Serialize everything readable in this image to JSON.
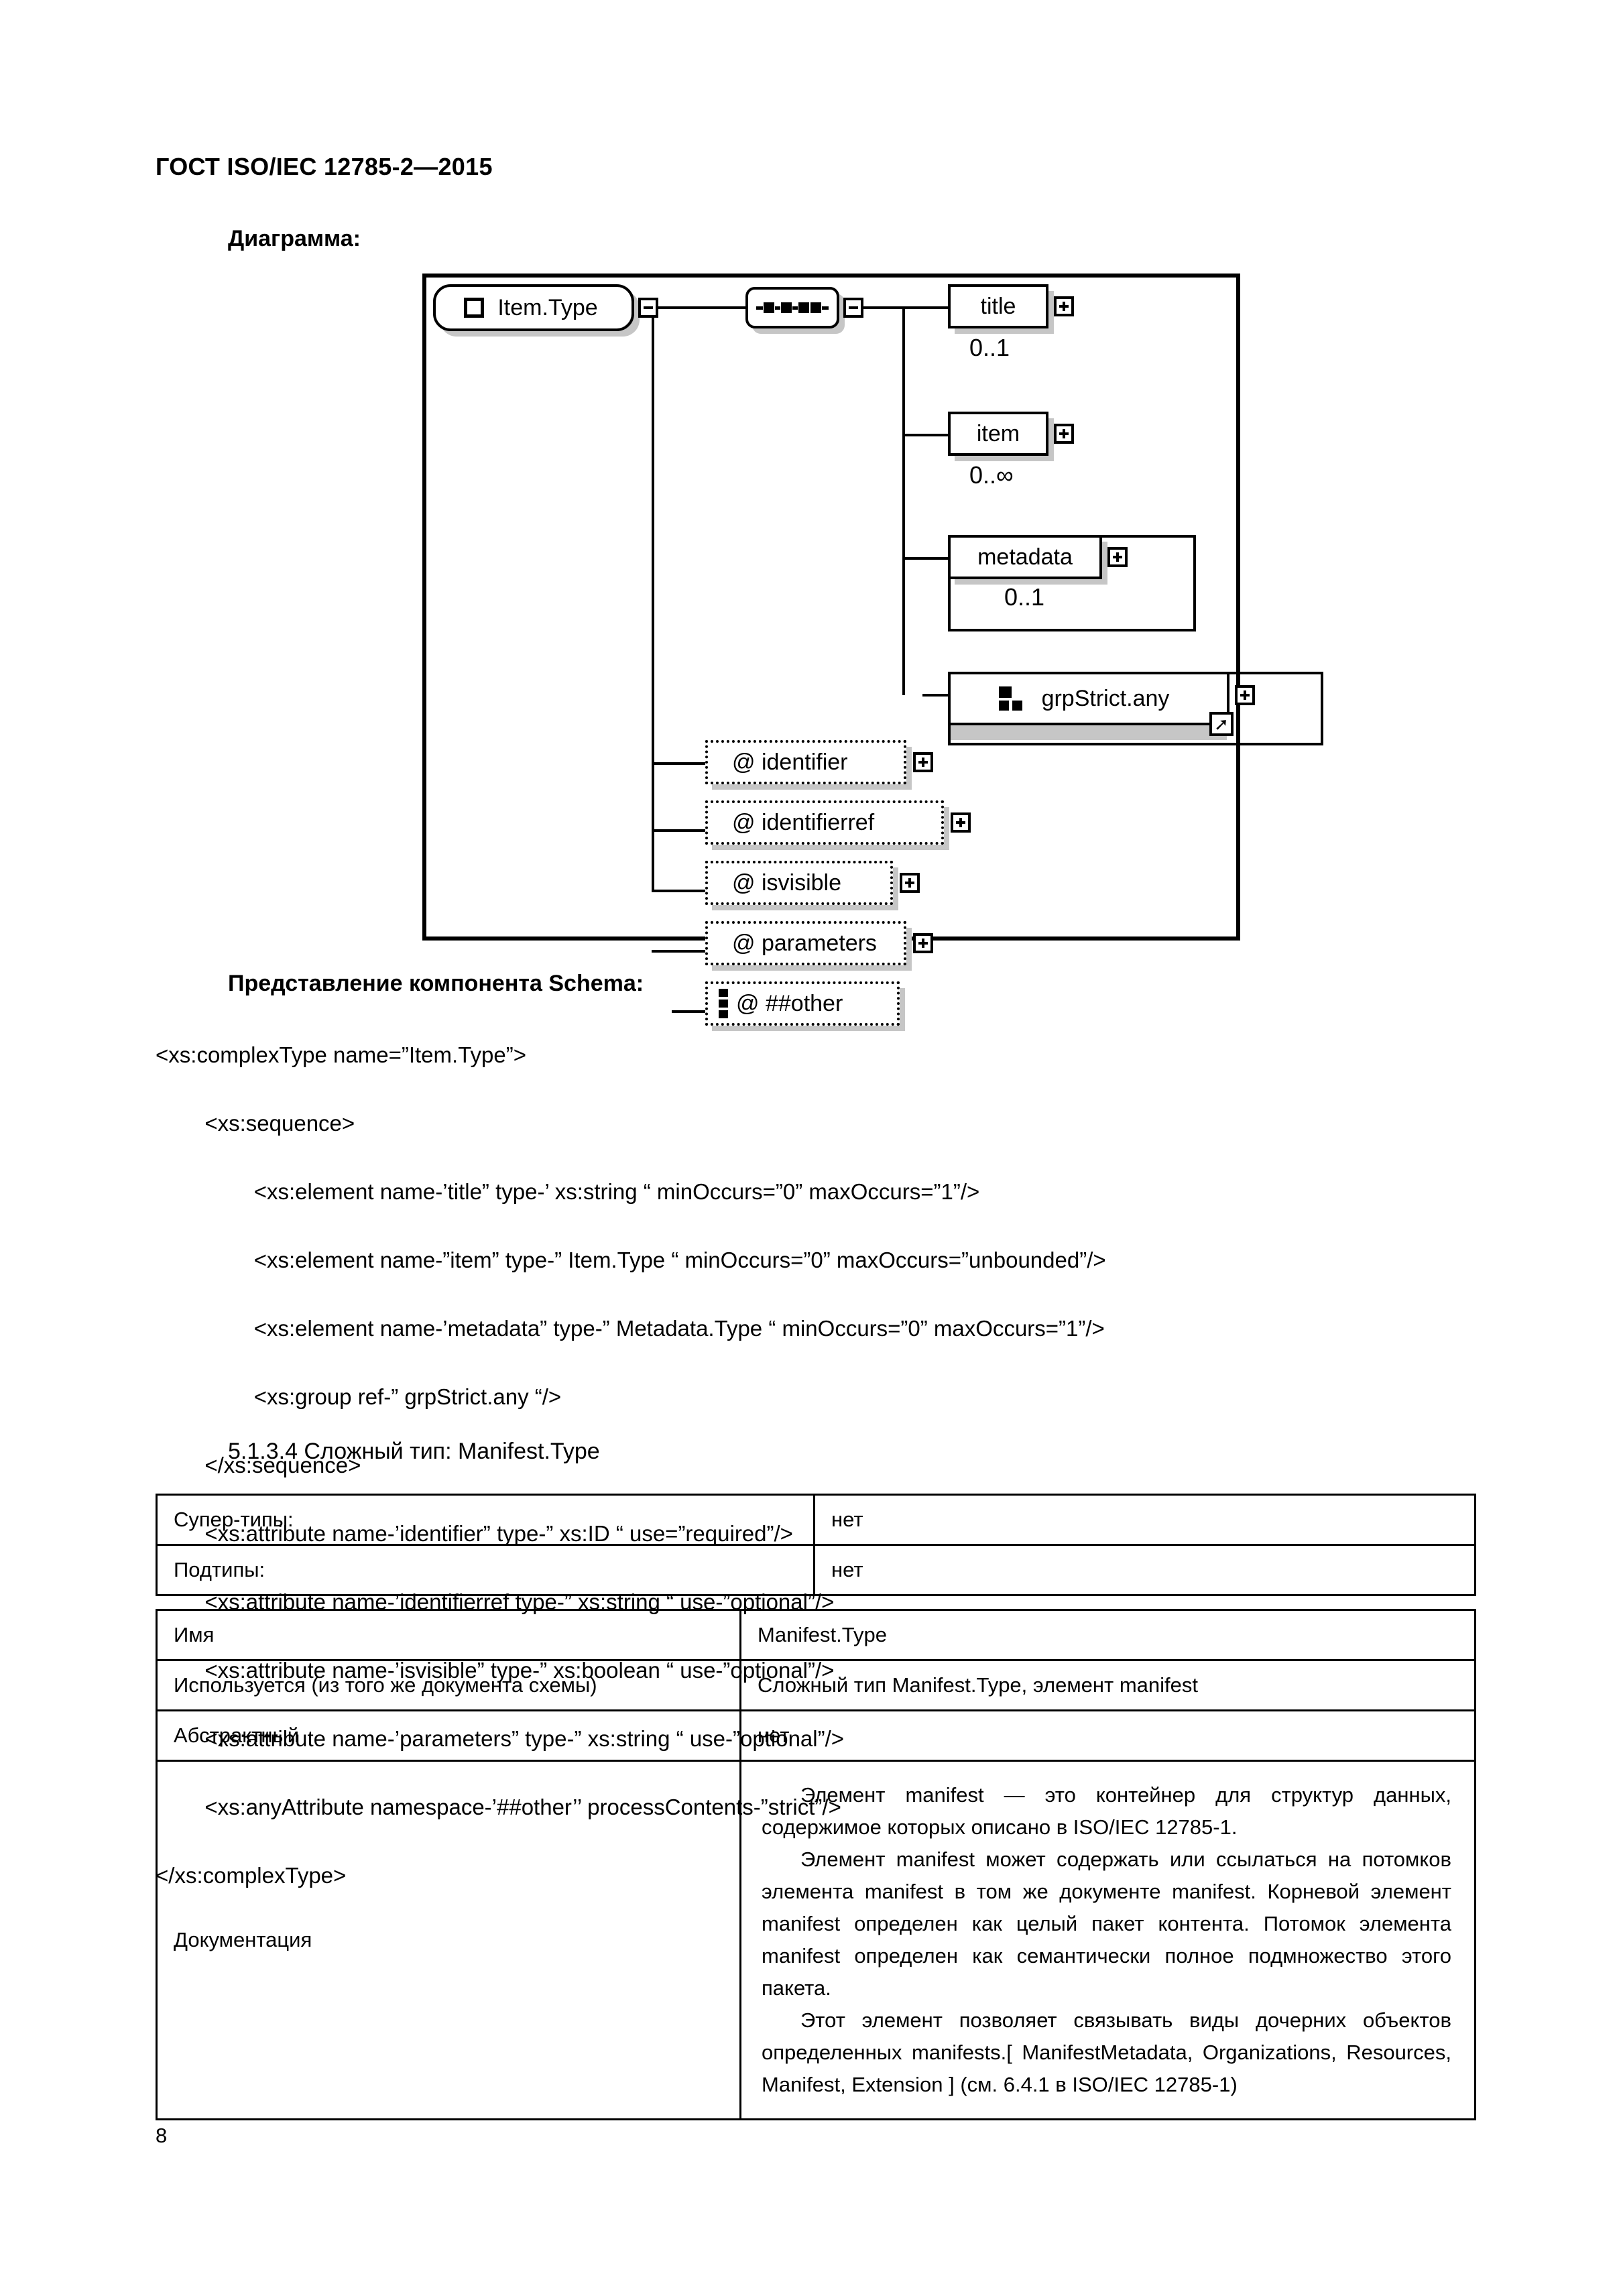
{
  "header": {
    "standard_title": "ГОСТ ISO/IEC 12785-2—2015"
  },
  "labels": {
    "diagram": "Диаграмма:",
    "schema_component": "Представление компонента Schema:",
    "clause": "5.1.3.4  Сложный тип: Manifest.Type"
  },
  "diagram": {
    "root": {
      "name": "Item.Type",
      "expander": "-"
    },
    "compositor": {
      "kind": "sequence",
      "expander": "-"
    },
    "elements": [
      {
        "name": "title",
        "cardinality": "0..1",
        "expander": "+"
      },
      {
        "name": "item",
        "cardinality": "0..∞",
        "expander": "+"
      },
      {
        "name": "metadata",
        "cardinality": "0..1",
        "expander": "+"
      },
      {
        "name": "grpStrict.any",
        "cardinality": "",
        "expander": "+"
      }
    ],
    "attributes": [
      {
        "name": "@ identifier",
        "expander": "+"
      },
      {
        "name": "@ identifierref",
        "expander": "+"
      },
      {
        "name": "@ isvisible",
        "expander": "+"
      },
      {
        "name": "@ parameters",
        "expander": "+"
      },
      {
        "name": "@ ##other",
        "expander": ""
      }
    ]
  },
  "code": {
    "lines": [
      "<xs:complexType name=”Item.Type”>",
      "        <xs:sequence>",
      "                <xs:element name-’title” type-’ xs:string “ minOccurs=”0” maxOccurs=”1”/>",
      "                <xs:element name-”item” type-” Item.Type “ minOccurs=”0” maxOccurs=”unbounded”/>",
      "                <xs:element name-’metadata” type-” Metadata.Type “ minOccurs=”0” maxOccurs=”1”/>",
      "                <xs:group ref-” grpStrict.any “/>",
      "        </xs:sequence>",
      "        <xs:attribute name-’identifier” type-” xs:ID “ use=”required”/>",
      "        <xs:attribute name-’identifierref type-” xs:string “ use-”optional”/>",
      "        <xs:attribute name-’isvisible” type-” xs:boolean “ use-”optional”/>",
      "        <xs:attribute name-’parameters” type-” xs:string “ use-”optional”/>",
      "        <xs:anyAttribute namespace-’##other’’ processContents-”strict”/>",
      "</xs:complexType>"
    ]
  },
  "table_types": {
    "rows": [
      {
        "key": "Супер-типы:",
        "value": "нет"
      },
      {
        "key": "Подтипы:",
        "value": "нет"
      }
    ]
  },
  "table_manifest": {
    "rows": [
      {
        "key": "Имя",
        "value": "Manifest.Type"
      },
      {
        "key": "Используется (из того же документа схемы)",
        "value": "Сложный тип Manifest.Type, элемент manifest"
      },
      {
        "key": "Абстрактный",
        "value": "нет"
      }
    ],
    "documentation_label": "Документация",
    "documentation_paragraphs": [
      "Элемент manifest — это контейнер для структур данных, содержимое которых описано в ISO/IEC 12785-1.",
      "Элемент manifest может содержать или ссылаться на потомков элемента manifest в том же документе manifest. Корневой элемент manifest определен как целый пакет контента. Потомок элемента manifest определен как семантически полное подмножество этого пакета.",
      "Этот элемент позволяет связывать виды дочерних объектов определенных manifests.[ ManifestMetadata, Organizations, Resources, Manifest, Extension ] (см. 6.4.1 в ISO/IEC 12785-1)"
    ]
  },
  "footer": {
    "page_number": "8"
  }
}
